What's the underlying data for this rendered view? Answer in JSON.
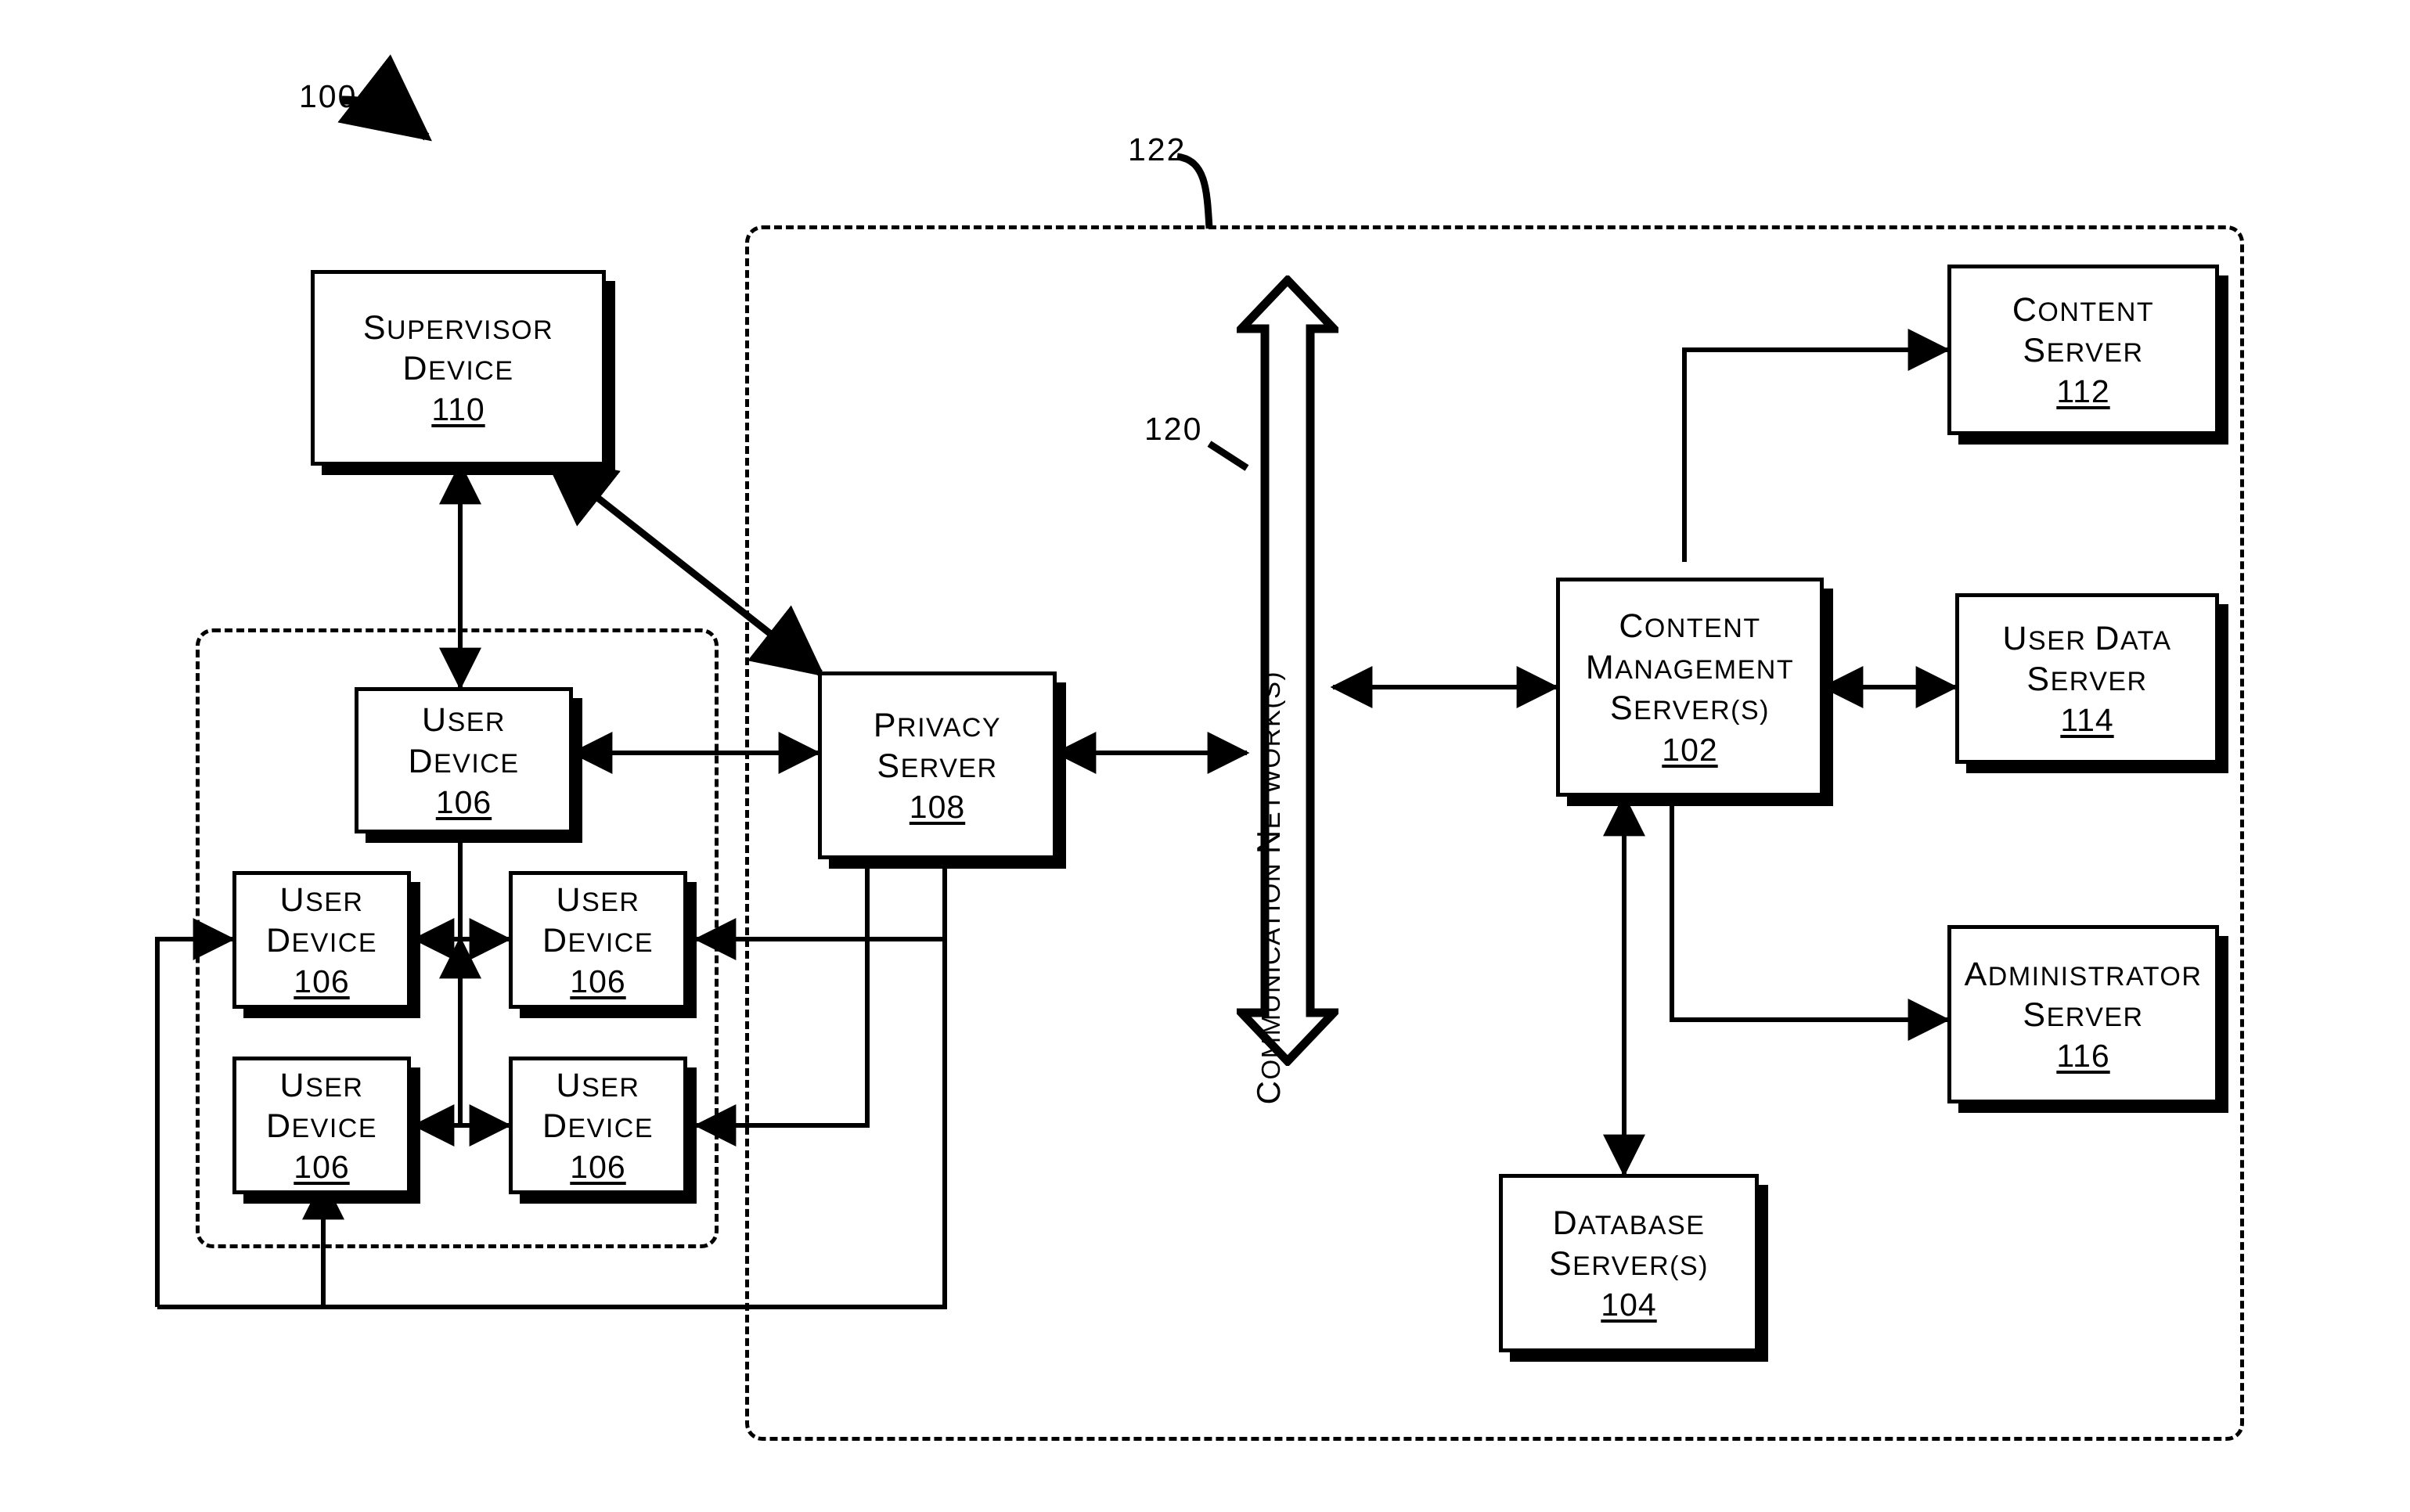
{
  "figure": {
    "reference_numeral": "100",
    "type": "patent-system-diagram"
  },
  "callouts": {
    "system": "100",
    "network": "120",
    "service_boundary": "122"
  },
  "nodes": {
    "supervisor_device": {
      "title_line1": "Supervisor",
      "title_line2": "Device",
      "ref": "110"
    },
    "user_device_top": {
      "title_line1": "User",
      "title_line2": "Device",
      "ref": "106"
    },
    "user_device_ml": {
      "title_line1": "User",
      "title_line2": "Device",
      "ref": "106"
    },
    "user_device_mr": {
      "title_line1": "User",
      "title_line2": "Device",
      "ref": "106"
    },
    "user_device_bl": {
      "title_line1": "User",
      "title_line2": "Device",
      "ref": "106"
    },
    "user_device_br": {
      "title_line1": "User",
      "title_line2": "Device",
      "ref": "106"
    },
    "privacy_server": {
      "title_line1": "Privacy",
      "title_line2": "Server",
      "ref": "108"
    },
    "content_management_server": {
      "title_line1": "Content",
      "title_line2": "Management",
      "title_line3": "Server(s)",
      "ref": "102"
    },
    "content_server": {
      "title_line1": "Content",
      "title_line2": "Server",
      "ref": "112"
    },
    "user_data_server": {
      "title_line1": "User Data",
      "title_line2": "Server",
      "ref": "114"
    },
    "administrator_server": {
      "title_line1": "Administrator",
      "title_line2": "Server",
      "ref": "116"
    },
    "database_server": {
      "title_line1": "Database",
      "title_line2": "Server(s)",
      "ref": "104"
    }
  },
  "network": {
    "label": "Communication Network(s)",
    "ref": "120",
    "shape": "double-headed-block-arrow-vertical"
  },
  "colors": {
    "stroke": "#000000",
    "fill": "#ffffff",
    "shadow": "#000000"
  }
}
